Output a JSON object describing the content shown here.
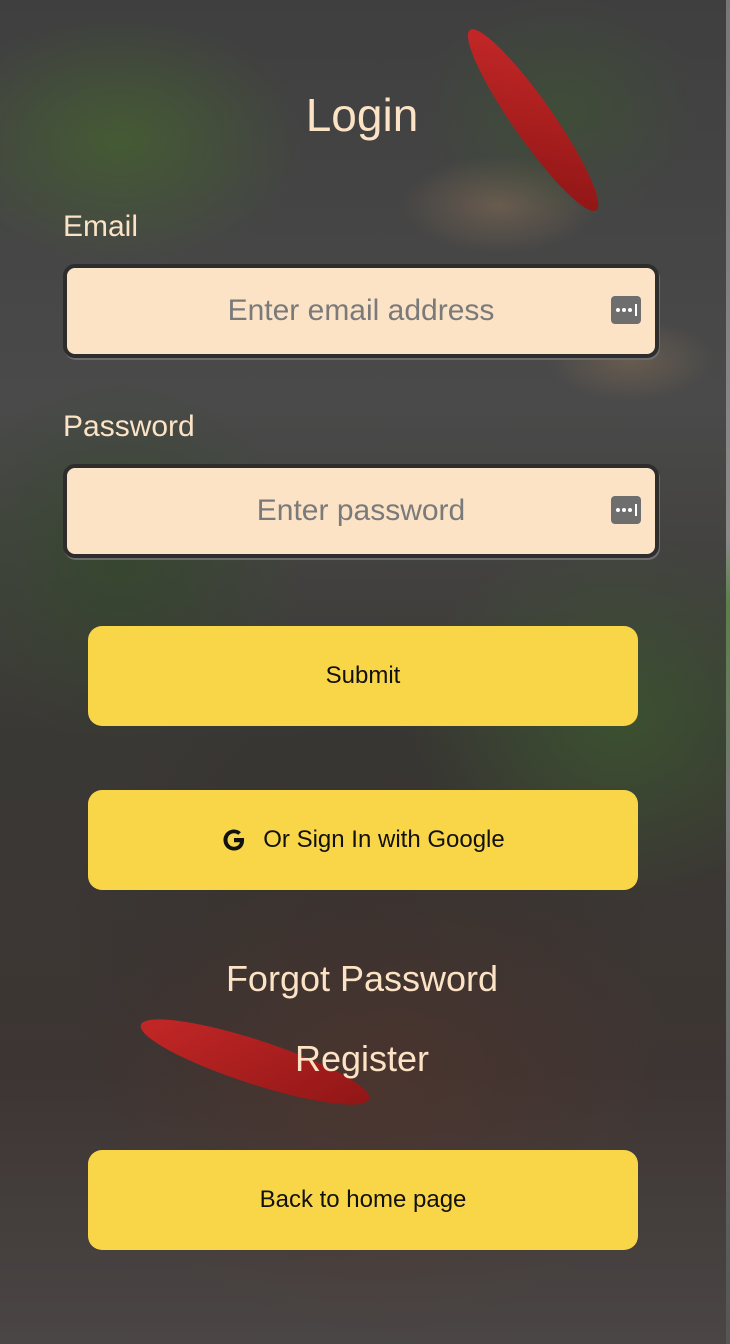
{
  "page": {
    "title": "Login"
  },
  "email": {
    "label": "Email",
    "placeholder": "Enter email address",
    "value": "",
    "icon": "password-manager-icon"
  },
  "password": {
    "label": "Password",
    "placeholder": "Enter password",
    "value": "",
    "icon": "password-manager-icon"
  },
  "buttons": {
    "submit": "Submit",
    "google": "Or Sign In with Google",
    "google_icon": "google-g-icon",
    "back": "Back to home page"
  },
  "links": {
    "forgot": "Forgot Password",
    "register": "Register"
  },
  "colors": {
    "accent_button": "#f9d648",
    "input_background": "#fce3c6",
    "label_text": "#fce3c6"
  }
}
